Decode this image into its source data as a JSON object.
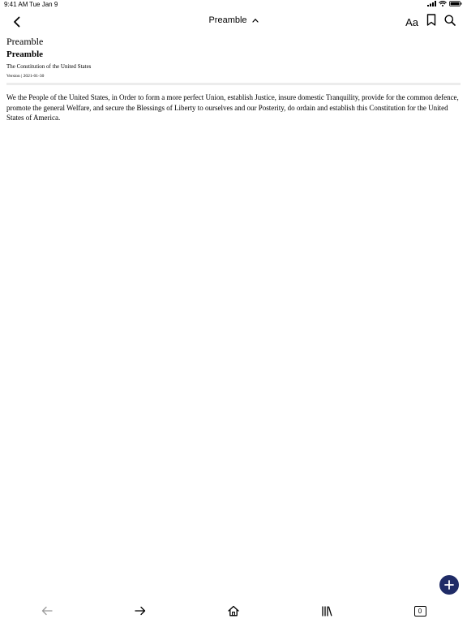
{
  "status_bar": {
    "time": "9:41 AM",
    "date": "Tue Jan 9"
  },
  "nav": {
    "title": "Preamble",
    "font_button_label": "Aa"
  },
  "header": {
    "section_label": "Preamble",
    "section_title": "Preamble",
    "document_name": "The Constitution of the United States",
    "version": "Version | 2021-01-30"
  },
  "body": {
    "text": "We the People of the United States, in Order to form a more perfect Union, establish Justice, insure domestic Tranquility, provide for the common defence, promote the general Welfare, and secure the Blessings of Liberty to ourselves and our Posterity, do ordain and establish this Constitution for the United States of America."
  },
  "toolbar": {
    "tabs_count": "0"
  },
  "colors": {
    "accent": "#1f2b66",
    "divider": "#ececec",
    "disabled_icon": "#9a9a9a"
  },
  "icons": {
    "back": "chevron-left-icon",
    "title_toggle": "chevron-up-icon",
    "bookmark": "bookmark-icon",
    "search": "search-icon",
    "fab": "plus-icon",
    "nav_back": "arrow-left-icon",
    "nav_forward": "arrow-right-icon",
    "home": "home-icon",
    "library": "library-icon"
  }
}
